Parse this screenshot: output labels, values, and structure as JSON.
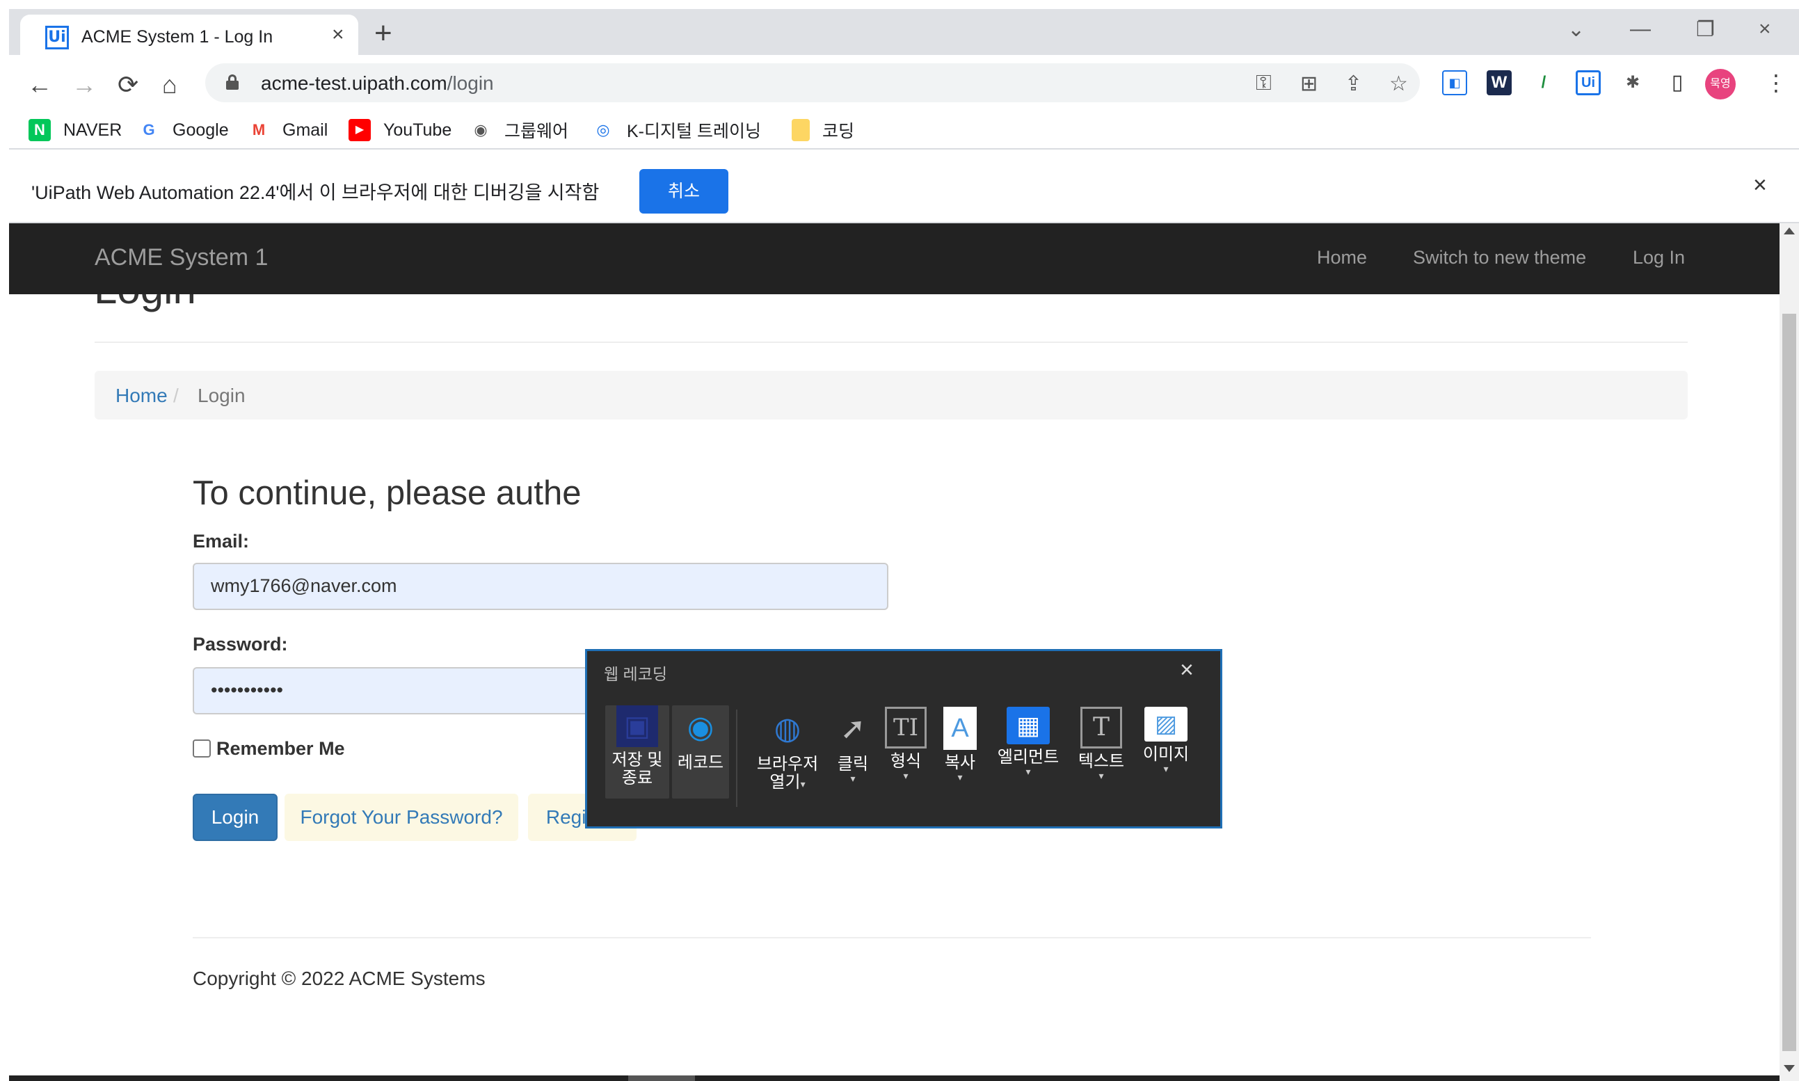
{
  "browser": {
    "tab_title": "ACME System 1 - Log In",
    "tab_favicon": "Ui",
    "url_host": "acme-test.uipath.com",
    "url_path": "/login",
    "profile_initials": "묵영",
    "icons": {
      "back": "←",
      "forward": "→",
      "reload": "⟳",
      "home": "⌂",
      "key": "⚿",
      "translate": "⊞",
      "share": "⇪",
      "star": "☆",
      "puzzle": "✱",
      "sidepanel": "▯",
      "menu": "⋮",
      "close": "×",
      "plus": "+",
      "minimize": "—",
      "restore": "❐",
      "chevron": "⌄"
    }
  },
  "bookmarks": [
    {
      "label": "NAVER",
      "icon": "N",
      "color": "#03c75a"
    },
    {
      "label": "Google",
      "icon": "G",
      "color": "#4285f4"
    },
    {
      "label": "Gmail",
      "icon": "M",
      "color": "#ea4335"
    },
    {
      "label": "YouTube",
      "icon": "▶",
      "color": "#ff0000"
    },
    {
      "label": "그룹웨어",
      "icon": "◉",
      "color": "#555555"
    },
    {
      "label": "K-디지털 트레이닝",
      "icon": "◎",
      "color": "#1a73e8"
    },
    {
      "label": "코딩",
      "icon": "",
      "color": "#fdd663"
    }
  ],
  "debugbar": {
    "message": "'UiPath Web Automation 22.4'에서 이 브라우저에 대한 디버깅을 시작함",
    "cancel_label": "취소",
    "close": "×"
  },
  "site": {
    "brand": "ACME System 1",
    "nav": [
      "Home",
      "Switch to new theme",
      "Log In"
    ],
    "heading": "Login",
    "breadcrumb": {
      "home": "Home",
      "sep": "/",
      "current": "Login"
    },
    "prompt": "To continue, please authe",
    "email_label": "Email:",
    "email_value": "wmy1766@naver.com",
    "password_label": "Password:",
    "password_value": "•••••••••••",
    "remember_label": "Remember Me",
    "login_button": "Login",
    "forgot_button": "Forgot Your Password?",
    "register_button": "Register",
    "copyright": "Copyright © 2022 ACME Systems"
  },
  "recorder": {
    "title": "웹 레코딩",
    "close": "×",
    "items": [
      {
        "label_line1": "저장 및",
        "label_line2": "종료",
        "icon": "▣"
      },
      {
        "label_line1": "레코드",
        "label_line2": "",
        "icon": "◉"
      },
      {
        "label_line1": "브라우저",
        "label_line2": "열기",
        "icon": "◍"
      },
      {
        "label_line1": "클릭",
        "label_line2": "",
        "icon": "➚"
      },
      {
        "label_line1": "형식",
        "label_line2": "",
        "icon": "TI"
      },
      {
        "label_line1": "복사",
        "label_line2": "",
        "icon": "A"
      },
      {
        "label_line1": "엘리먼트",
        "label_line2": "",
        "icon": "▦"
      },
      {
        "label_line1": "텍스트",
        "label_line2": "",
        "icon": "T"
      },
      {
        "label_line1": "이미지",
        "label_line2": "",
        "icon": "▨"
      }
    ],
    "caret": "▾"
  }
}
